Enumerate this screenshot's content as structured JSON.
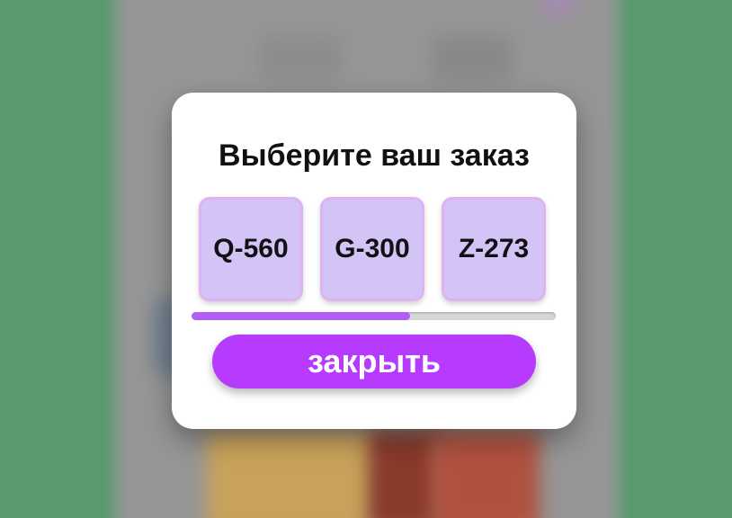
{
  "dialog": {
    "title": "Выберите ваш заказ",
    "options": [
      {
        "label": "Q-560"
      },
      {
        "label": "G-300"
      },
      {
        "label": "Z-273"
      }
    ],
    "progress": 0.6,
    "close_label": "закрыть"
  },
  "colors": {
    "modal_background": "#ffffff",
    "option_fill": "#d3c3f7",
    "option_border": "#ddb3f2",
    "progress_fill": "#b05ef5",
    "progress_track": "#d6d6d6",
    "button_accent": "#b73bff",
    "page_background": "#5a9a6e"
  }
}
